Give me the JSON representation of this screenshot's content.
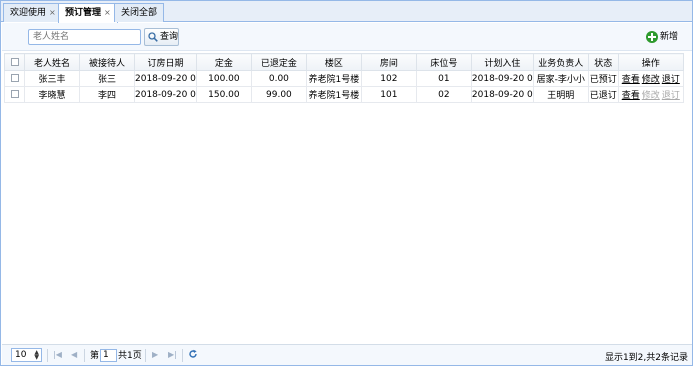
{
  "tabs": [
    {
      "label": "欢迎使用",
      "close": "×"
    },
    {
      "label": "预订管理",
      "close": "×"
    },
    {
      "label": "关闭全部"
    }
  ],
  "toolbar": {
    "search_placeholder": "老人姓名",
    "search_label": "查询",
    "add_label": "新增"
  },
  "grid": {
    "headers": [
      "老人姓名",
      "被接待人",
      "订房日期",
      "定金",
      "已退定金",
      "楼区",
      "房间",
      "床位号",
      "计划入住",
      "业务负责人",
      "状态",
      "操作"
    ],
    "rows": [
      {
        "name": "张三丰",
        "host": "张三",
        "date": "2018-09-20 0",
        "deposit": "100.00",
        "refunded": "0.00",
        "building": "养老院1号楼",
        "room": "102",
        "bed": "01",
        "plan": "2018-09-20 0",
        "manager": "居家-李小小",
        "status": "已预订",
        "ops": [
          "查看",
          "修改",
          "退订"
        ]
      },
      {
        "name": "李晓慧",
        "host": "李四",
        "date": "2018-09-20 0",
        "deposit": "150.00",
        "refunded": "99.00",
        "building": "养老院1号楼",
        "room": "101",
        "bed": "02",
        "plan": "2018-09-20 0",
        "manager": "王明明",
        "status": "已退订",
        "ops": [
          "查看",
          "修改",
          "退订"
        ]
      }
    ]
  },
  "pager": {
    "page_size": "10",
    "page_prefix": "第",
    "page_value": "1",
    "page_suffix": "共1页",
    "total_text": "显示1到2,共2条记录"
  }
}
